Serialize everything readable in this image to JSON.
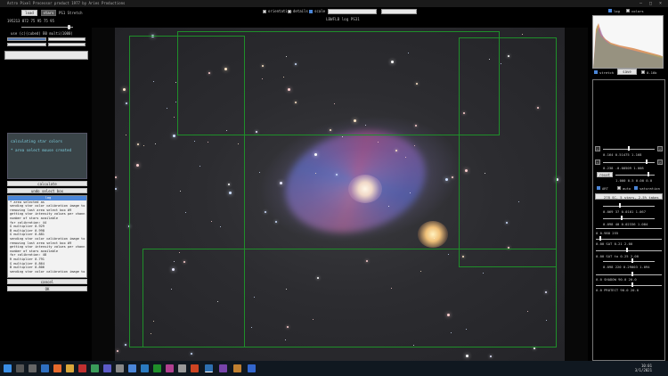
{
  "window": {
    "title": "Astro Pixel Processor product 1977 by Aries Productions"
  },
  "left": {
    "tab_load": "load",
    "tab_stars": "stars",
    "tab_stretch": "PS1 Stretch",
    "readout": "195213 872  75  95      75  95",
    "mode_label": "use (c)(cubed) B0 multi(1000)",
    "status_lines": [
      "calculating star colors",
      "* area select mouse created"
    ],
    "calc_btn": "calculate",
    "undo_btn": "undo select box",
    "log_title": "log",
    "log_lines": [
      "* area selected as",
      "sending star color calibration image to",
      "removing last area select box #9",
      "getting star intensity values per chann",
      "number of stars available",
      "for calibration: 44",
      "G multiplier 0.929",
      "B multiplier 0.998",
      "G multiplier 0.881",
      "sending star color calibration image to",
      "removing last area select box #9",
      "getting star intensity values per chann",
      "number of stars available",
      "for calibration: 48",
      "R multiplier 0.791",
      "G multiplier 0.864",
      "B multiplier 0.806",
      "sending star color calibration image to"
    ],
    "cancel_btn": "cancel",
    "ok_btn": "OK"
  },
  "top_options": {
    "items": [
      {
        "label": "orientation",
        "checked": false
      },
      {
        "label": "details",
        "checked": false
      },
      {
        "label": "scale",
        "checked": true
      }
    ]
  },
  "image": {
    "title": "LBWFLB log PS31"
  },
  "right": {
    "hist_opt1": "log",
    "hist_opt2": "colors",
    "stretch_label": "stretch",
    "reset_top": "save",
    "bit_label": "0-16b",
    "row1": "0.164   0.51475   1.168",
    "row2": "0.238   -0.00509  1.008",
    "reset_btn": "reset",
    "row3": "1.000   0.5 0.00   0.0",
    "chk1": "ART",
    "chk2": "auto",
    "chk3": "saturation",
    "mode_select": "278 SC, 5 stars, 2.5% takes",
    "row4": "0.069   37 0.0101   1.067",
    "row5": "0.098   40 0.02336  1.084",
    "row6": "0   0.988   255",
    "row7": "0.00   SAT 0.21   2.00",
    "row8": "0.00   SAT to 0.25  2.00",
    "row9": "0.098  220 0.29003  1.094",
    "row10": "0.0    SHADOW 90.0   20.0",
    "row11": "0.0    PROTECT 90.0  20.0"
  },
  "taskbar": {
    "time": "10:01",
    "date": "3/1/2021"
  },
  "colors": {
    "accent": "#4b86d8",
    "select_box": "#1f8f2a",
    "status_text": "#7fd0e0"
  }
}
